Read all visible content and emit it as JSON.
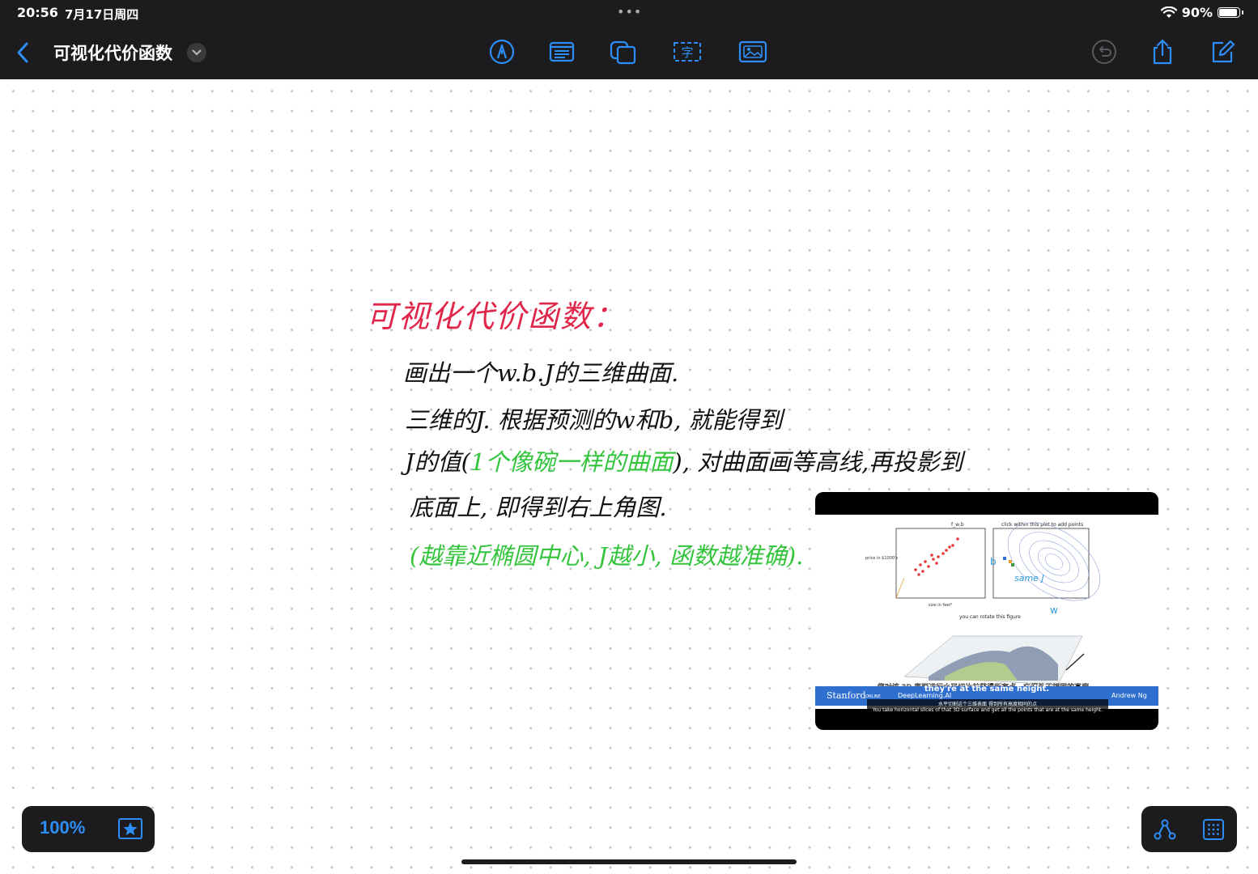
{
  "status": {
    "time": "20:56",
    "date": "7月17日周四",
    "battery": "90%",
    "battery_level": 0.9,
    "dots": "•••"
  },
  "toolbar": {
    "title": "可视化代价函数",
    "tools": [
      "pen-tool-icon",
      "text-note-icon",
      "shapes-icon",
      "text-box-icon",
      "image-insert-icon"
    ]
  },
  "note": {
    "heading": "可视化代价函数：",
    "line1": "画出一个w.b.J的三维曲面.",
    "line2": "三维的J. 根据预测的w和b, 就能得到",
    "line3_black_a": "J的值(",
    "line3_green": "1个像碗一样的曲面",
    "line3_black_b": "), 对曲面画等高线,再投影到",
    "line4": "底面上, 即得到右上角图.",
    "line5": "(越靠近椭圆中心, J越小, 函数越准确)."
  },
  "video": {
    "plot_left_title": "f_w,b",
    "plot_left_ylabel": "price in $1000's",
    "plot_left_xlabel": "size in feet²",
    "plot_right_title": "click within this plot to add points",
    "annotation_same_j": "same J",
    "annotation_b": "b",
    "annotation_w": "w",
    "rotate_hint": "you can rotate this figure",
    "subtitle_cn": "您对该 3D 表面进行水平切片并获得所有点，它们处于相同的高度。",
    "subtitle_en": "they're at the same height.",
    "brand_left": "Stanford",
    "brand_left_small": "ONLINE",
    "brand_mid": "DeepLearning.AI",
    "brand_right": "Andrew Ng",
    "caption_cn": "水平切割这个三维表面 得到所有高度相同的点",
    "caption_en": "You take horizontal slices of that 3D surface and get all the points that are at the same height."
  },
  "zoom": {
    "label": "100%"
  }
}
